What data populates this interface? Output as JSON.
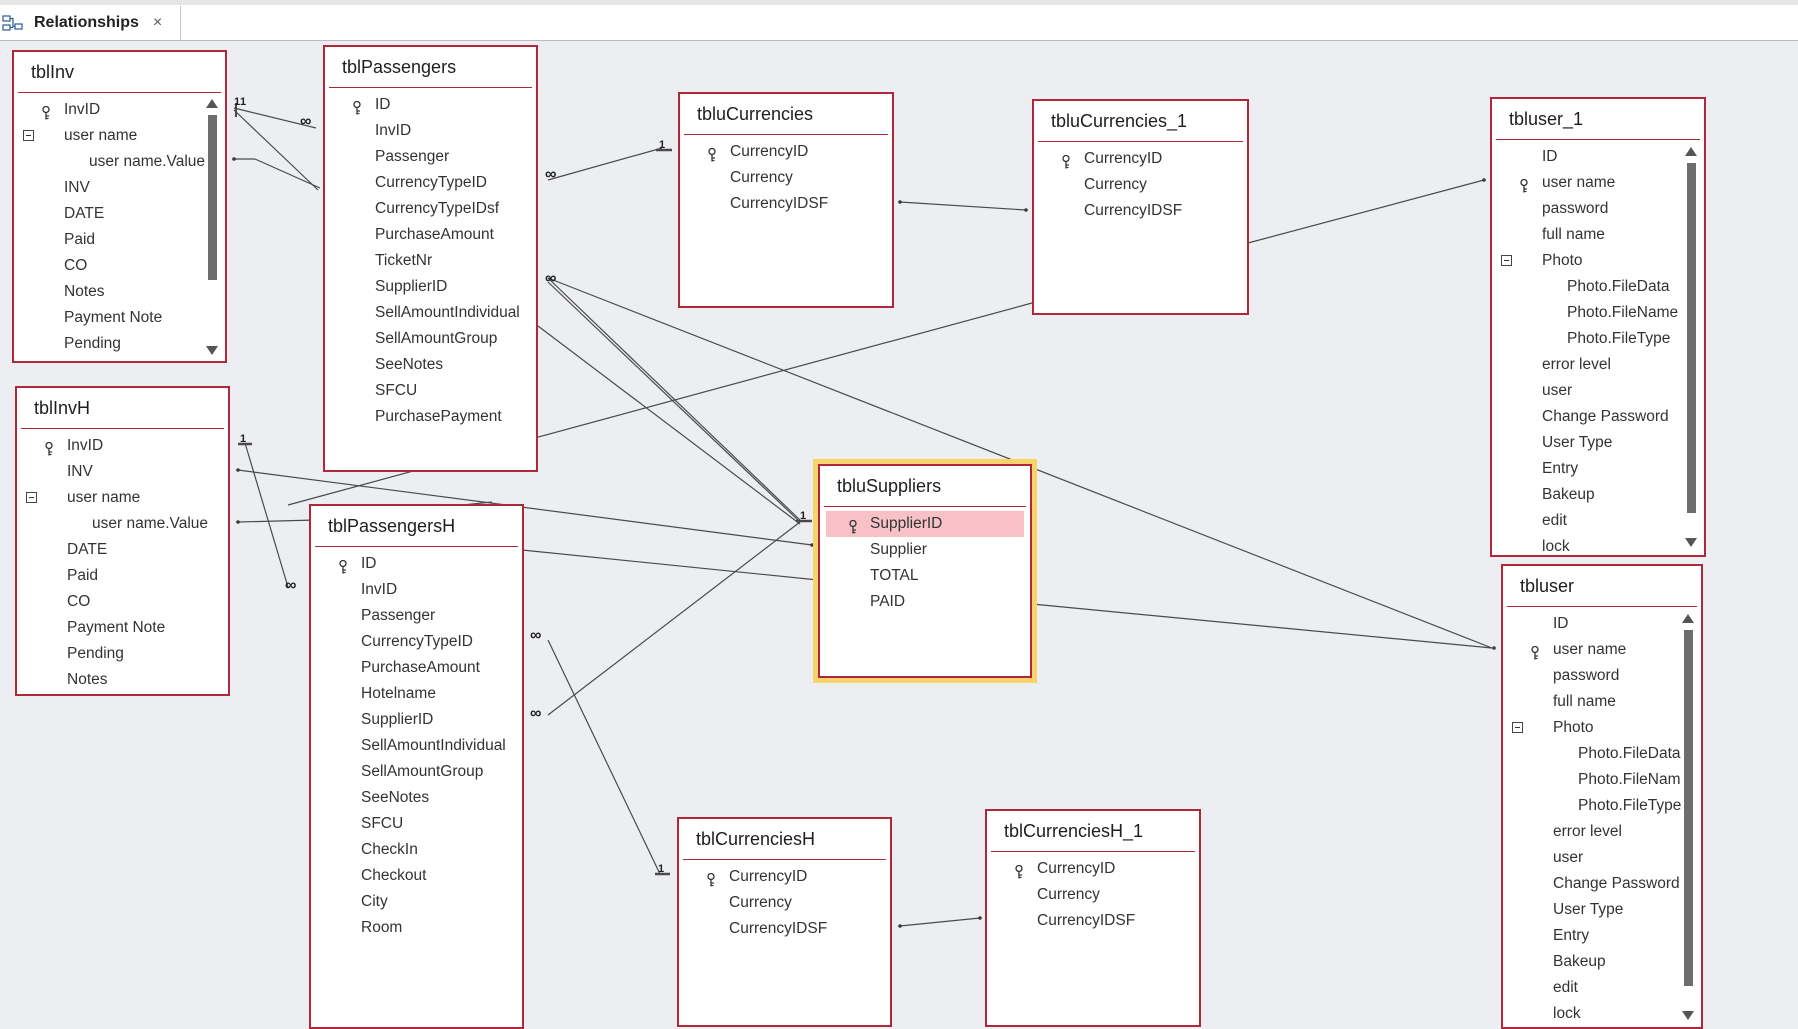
{
  "document_tab": {
    "label": "Relationships",
    "close_glyph": "×",
    "icon": "relationships-icon"
  },
  "tables": {
    "tblInv": {
      "title": "tblInv",
      "fields": [
        "InvID",
        "user name",
        "user name.Value",
        "INV",
        "DATE",
        "Paid",
        "CO",
        "Notes",
        "Payment Note",
        "Pending"
      ]
    },
    "tblPassengers": {
      "title": "tblPassengers",
      "fields": [
        "ID",
        "InvID",
        "Passenger",
        "CurrencyTypeID",
        "CurrencyTypeIDsf",
        "PurchaseAmount",
        "TicketNr",
        "SupplierID",
        "SellAmountIndividual",
        "SellAmountGroup",
        "SeeNotes",
        "SFCU",
        "PurchasePayment"
      ]
    },
    "tbluCurrencies": {
      "title": "tbluCurrencies",
      "fields": [
        "CurrencyID",
        "Currency",
        "CurrencyIDSF"
      ]
    },
    "tbluCurrencies_1": {
      "title": "tbluCurrencies_1",
      "fields": [
        "CurrencyID",
        "Currency",
        "CurrencyIDSF"
      ]
    },
    "tbluser_1": {
      "title": "tbluser_1",
      "fields": [
        "ID",
        "user name",
        "password",
        "full name",
        "Photo",
        "Photo.FileData",
        "Photo.FileName",
        "Photo.FileType",
        "error level",
        "user",
        "Change Password",
        "User Type",
        "Entry",
        "Bakeup",
        "edit",
        "lock"
      ]
    },
    "tblInvH": {
      "title": "tblInvH",
      "fields": [
        "InvID",
        "INV",
        "user name",
        "user name.Value",
        "DATE",
        "Paid",
        "CO",
        "Payment Note",
        "Pending",
        "Notes"
      ]
    },
    "tblPassengersH": {
      "title": "tblPassengersH",
      "fields": [
        "ID",
        "InvID",
        "Passenger",
        "CurrencyTypeID",
        "PurchaseAmount",
        "Hotelname",
        "SupplierID",
        "SellAmountIndividual",
        "SellAmountGroup",
        "SeeNotes",
        "SFCU",
        "CheckIn",
        "Checkout",
        "City",
        "Room"
      ]
    },
    "tbluSuppliers": {
      "title": "tbluSuppliers",
      "fields": [
        "SupplierID",
        "Supplier",
        "TOTAL",
        "PAID"
      ]
    },
    "tblCurrenciesH": {
      "title": "tblCurrenciesH",
      "fields": [
        "CurrencyID",
        "Currency",
        "CurrencyIDSF"
      ]
    },
    "tblCurrenciesH_1": {
      "title": "tblCurrenciesH_1",
      "fields": [
        "CurrencyID",
        "Currency",
        "CurrencyIDSF"
      ]
    },
    "tbluser": {
      "title": "tbluser",
      "fields": [
        "ID",
        "user name",
        "password",
        "full name",
        "Photo",
        "Photo.FileData",
        "Photo.FileName",
        "Photo.FileType",
        "error level",
        "user",
        "Change Password",
        "User Type",
        "Entry",
        "Bakeup",
        "edit",
        "lock"
      ]
    }
  },
  "cardinality": {
    "one": "1",
    "many": "∞"
  },
  "colors": {
    "table_border": "#b1273a",
    "selected_highlight": "#f6d36b",
    "selected_row": "#f7c1c6",
    "line": "#4a4a4a"
  }
}
